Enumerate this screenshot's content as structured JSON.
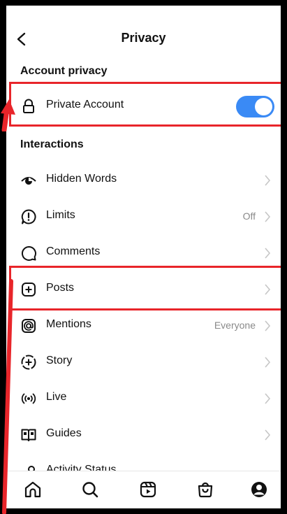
{
  "header": {
    "title": "Privacy"
  },
  "sections": {
    "account_privacy": "Account privacy",
    "interactions": "Interactions"
  },
  "private_account": {
    "label": "Private Account",
    "enabled": true
  },
  "rows": {
    "hidden_words": {
      "label": "Hidden Words"
    },
    "limits": {
      "label": "Limits",
      "value": "Off"
    },
    "comments": {
      "label": "Comments"
    },
    "posts": {
      "label": "Posts"
    },
    "mentions": {
      "label": "Mentions",
      "value": "Everyone"
    },
    "story": {
      "label": "Story"
    },
    "live": {
      "label": "Live"
    },
    "guides": {
      "label": "Guides"
    },
    "activity_status": {
      "label": "Activity Status"
    }
  },
  "tabbar": {
    "icons": [
      "home-icon",
      "search-icon",
      "reels-icon",
      "shop-icon",
      "profile-icon"
    ]
  },
  "colors": {
    "toggle_on": "#3a8af5",
    "highlight": "#e8252a"
  }
}
